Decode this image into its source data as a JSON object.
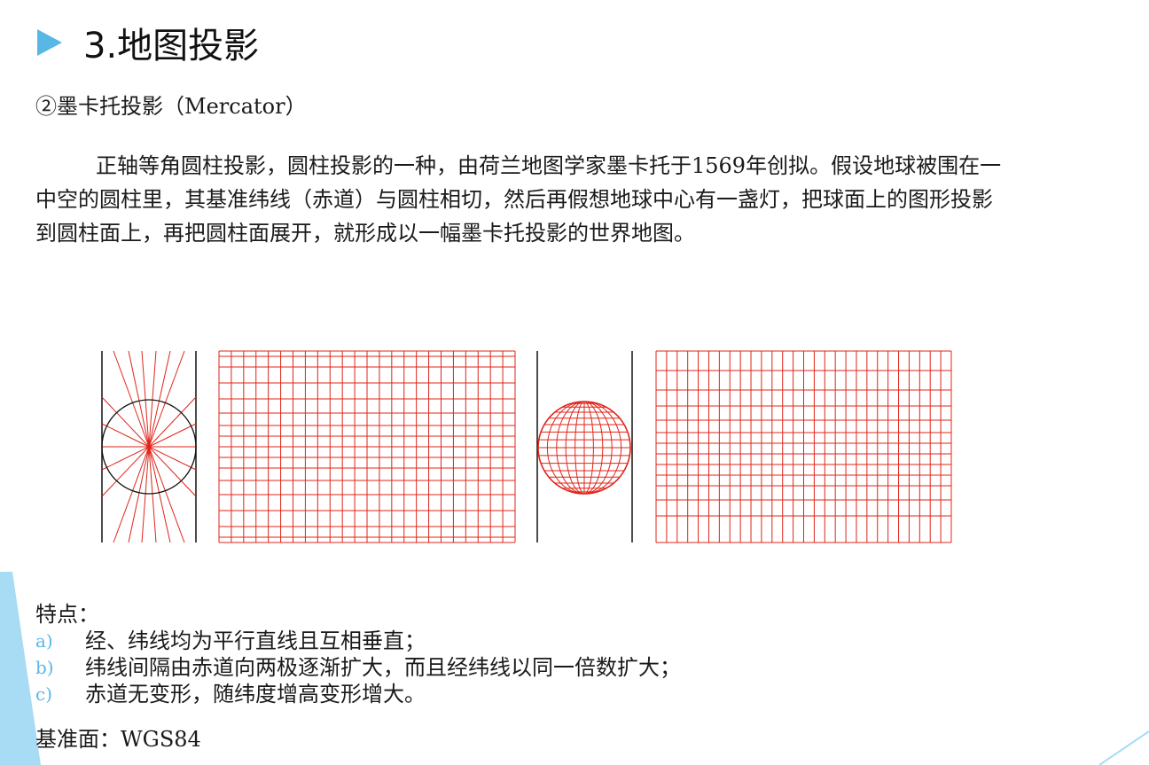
{
  "slide": {
    "title": "3.地图投影",
    "subtitle": "②墨卡托投影（Mercator）",
    "paragraph": "正轴等角圆柱投影，圆柱投影的一种，由荷兰地图学家墨卡托于1569年创拟。假设地球被围在一中空的圆柱里，其基准纬线（赤道）与圆柱相切，然后再假想地球中心有一盏灯，把球面上的图形投影到圆柱面上，再把圆柱面展开，就形成以一幅墨卡托投影的世界地图。",
    "features": {
      "heading": "特点：",
      "items": [
        {
          "letter": "a)",
          "text": "经、纬线均为平行直线且互相垂直；"
        },
        {
          "letter": "b)",
          "text": "纬线间隔由赤道向两极逐渐扩大，而且经纬线以同一倍数扩大；"
        },
        {
          "letter": "c)",
          "text": "赤道无变形，随纬度增高变形增大。"
        }
      ]
    },
    "datum": "基准面：WGS84"
  },
  "colors": {
    "accent": "#59b7e6",
    "grid_red": "#e0241a",
    "outline": "#111111"
  },
  "icons": {
    "title_bullet": "play-triangle-icon"
  }
}
